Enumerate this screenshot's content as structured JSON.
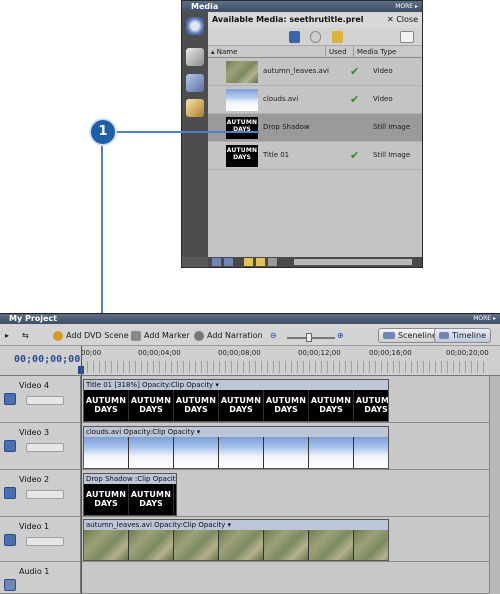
{
  "media": {
    "panel_title": "Media",
    "more": "MORE ▸",
    "header": "Available Media: seethrutitle.prel",
    "close_label": "✕ Close",
    "columns": [
      "▴ Name",
      "Used",
      "Media Type"
    ],
    "items": [
      {
        "name": "autumn_leaves.avi",
        "used": "✔",
        "type": "Video",
        "thumb": "leaves"
      },
      {
        "name": "clouds.avi",
        "used": "✔",
        "type": "Video",
        "thumb": "clouds"
      },
      {
        "name": "Drop Shadow",
        "used": "",
        "type": "Still Image",
        "thumb": "autumn",
        "selected": true
      },
      {
        "name": "Title 01",
        "used": "✔",
        "type": "Still Image",
        "thumb": "autumn"
      }
    ],
    "thumb_text": [
      "AUTUMN",
      "DAYS"
    ]
  },
  "callout": "1",
  "timeline": {
    "panel_title": "My Project",
    "more": "MORE ▸",
    "tools": {
      "add_dvd_scene": "Add DVD Scene",
      "add_marker": "Add Marker",
      "add_narration": "Add Narration",
      "sceneline": "Sceneline",
      "timeline": "Timeline"
    },
    "timecode": "00;00;00;00",
    "ticks": [
      "00;00",
      "00;00;04;00",
      "00;00;08;00",
      "00;00;12;00",
      "00;00;16;00",
      "00;00;20;00"
    ],
    "tracks": [
      {
        "label": "Video 4",
        "clip": "Title 01 [318%] Opacity:Clip Opacity ▾"
      },
      {
        "label": "Video 3",
        "clip": "clouds.avi Opacity:Clip Opacity ▾"
      },
      {
        "label": "Video 2",
        "clip": "Drop Shadow :Clip Opacity ▾"
      },
      {
        "label": "Video 1",
        "clip": "autumn_leaves.avi Opacity:Clip Opacity ▾"
      },
      {
        "label": "Audio 1",
        "clip": ""
      }
    ]
  },
  "colors": {
    "accent": "#1f5fa8",
    "title_bar": "#4a5b74",
    "playhead": "#cc2222",
    "used_check": "#2c8a2c"
  }
}
